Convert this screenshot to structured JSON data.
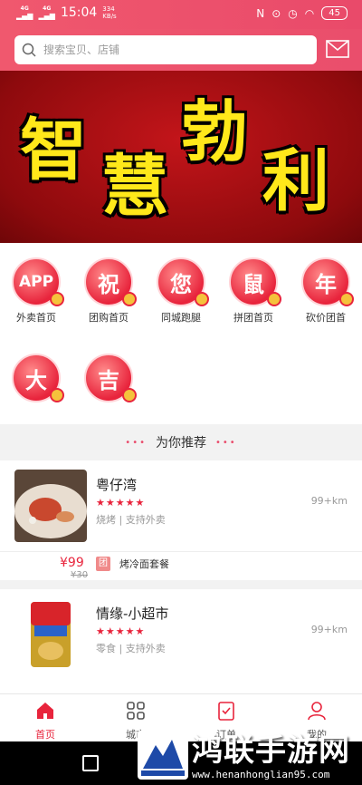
{
  "status_bar": {
    "net1": "4G",
    "net2": "4G",
    "time": "15:04",
    "speed": "334",
    "speed_unit": "KB/s",
    "battery": "45"
  },
  "search": {
    "placeholder": "搜索宝贝、店铺"
  },
  "banner": {
    "chars": [
      "智",
      "慧",
      "勃",
      "利"
    ]
  },
  "categories": [
    {
      "icon_text": "APP",
      "label": "外卖首页"
    },
    {
      "icon_text": "祝",
      "label": "团购首页"
    },
    {
      "icon_text": "您",
      "label": "同城跑腿"
    },
    {
      "icon_text": "鼠",
      "label": "拼团首页"
    },
    {
      "icon_text": "年",
      "label": "砍价团首"
    },
    {
      "icon_text": "大",
      "label": ""
    },
    {
      "icon_text": "吉",
      "label": ""
    }
  ],
  "recommend": {
    "dots": "•••",
    "title": "为你推荐"
  },
  "shops": [
    {
      "name": "粤仔湾",
      "stars": "★★★★★",
      "tags": "烧烤 | 支持外卖",
      "distance": "99+km",
      "deal": {
        "price": "¥99",
        "old_price": "¥30",
        "badge": "团",
        "name": "烤冷面套餐"
      }
    },
    {
      "name": "情缘-小超市",
      "stars": "★★★★★",
      "tags": "零食 | 支持外卖",
      "distance": "99+km"
    }
  ],
  "tabs": [
    {
      "label": "首页",
      "icon": "home-icon"
    },
    {
      "label": "城市",
      "icon": "grid-icon"
    },
    {
      "label": "订单",
      "icon": "clipboard-icon"
    },
    {
      "label": "我的",
      "icon": "user-icon"
    }
  ],
  "watermark": {
    "title": "鸿联手游网",
    "url": "www.henanhonglian95.com"
  },
  "colors": {
    "brand": "#e94a6a",
    "accent": "#e8243c",
    "banner_text": "#ffe81a"
  }
}
